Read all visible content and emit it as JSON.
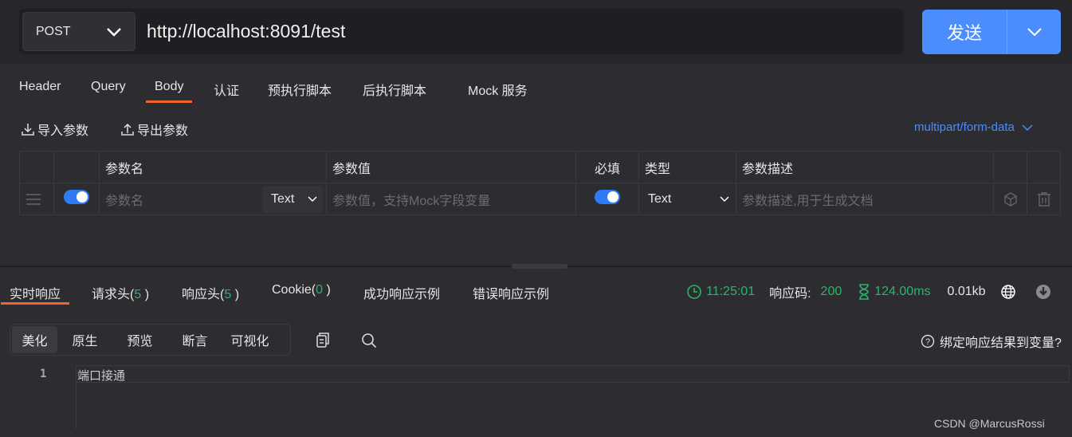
{
  "request": {
    "method": "POST",
    "url": "http://localhost:8091/test",
    "send_label": "发送"
  },
  "tabs": [
    "Header",
    "Query",
    "Body",
    "认证",
    "预执行脚本",
    "后执行脚本",
    "Mock 服务"
  ],
  "active_tab": "Body",
  "toolbar": {
    "import_label": "导入参数",
    "export_label": "导出参数",
    "content_type": "multipart/form-data"
  },
  "table": {
    "headers": [
      "参数名",
      "参数值",
      "必填",
      "类型",
      "参数描述"
    ],
    "row": {
      "enabled": true,
      "name_placeholder": "参数名",
      "name_type": "Text",
      "value_placeholder": "参数值，支持Mock字段变量",
      "required": true,
      "type": "Text",
      "desc_placeholder": "参数描述,用于生成文档"
    }
  },
  "response": {
    "tabs": {
      "realtime": "实时响应",
      "req_headers": "请求头(",
      "req_headers_count": "5",
      "resp_headers": "响应头(",
      "resp_headers_count": "5",
      "cookie": "Cookie(",
      "cookie_count": "0",
      "close": ")",
      "success_example": "成功响应示例",
      "error_example": "错误响应示例"
    },
    "time": "11:25:01",
    "code_label": "响应码:",
    "code": "200",
    "duration": "124.00ms",
    "size": "0.01kb",
    "view_tabs": [
      "美化",
      "原生",
      "预览",
      "断言",
      "可视化"
    ],
    "bind_label": "绑定响应结果到变量?",
    "lines": [
      {
        "num": "1",
        "text": "端口接通"
      }
    ]
  },
  "colors": {
    "accent": "#4b8dfc",
    "active_tab": "#f0642d",
    "success": "#2db46a"
  },
  "watermark": "CSDN @MarcusRossi"
}
